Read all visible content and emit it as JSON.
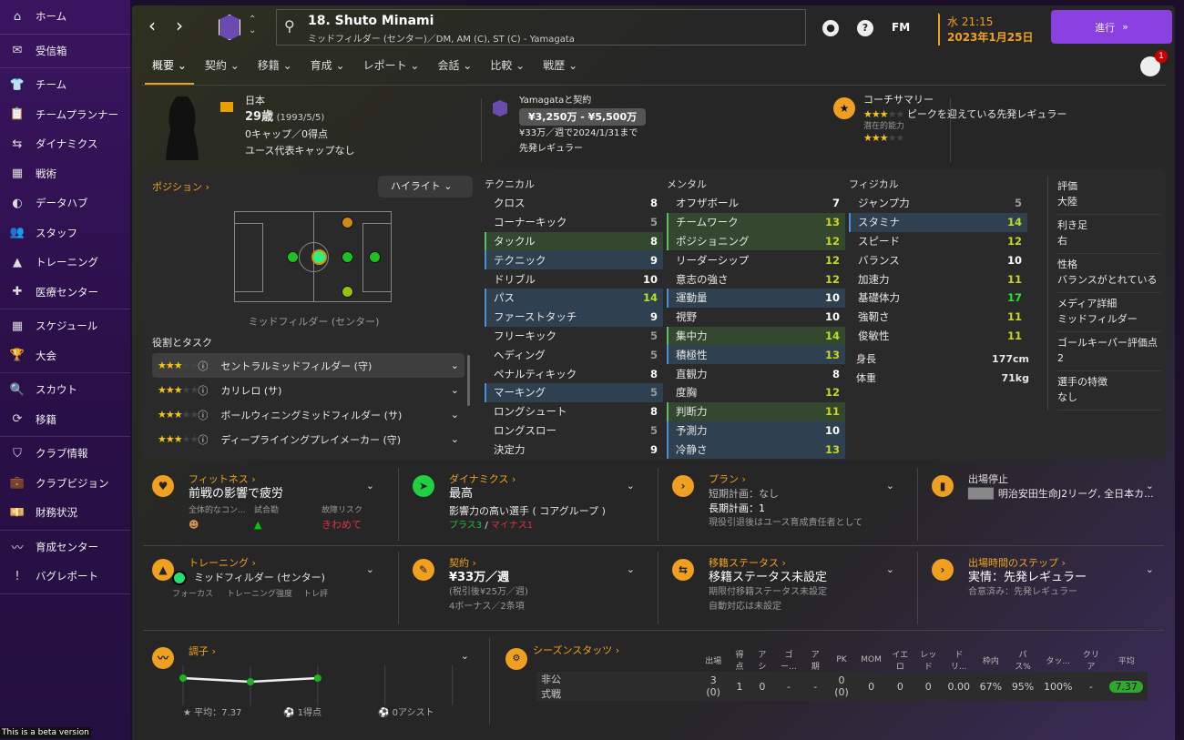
{
  "sidebar": {
    "groups": [
      [
        {
          "label": "ホーム",
          "icon": "home-icon",
          "glyph": "⌂"
        }
      ],
      [
        {
          "label": "受信箱",
          "icon": "inbox-icon",
          "glyph": "✉"
        }
      ],
      [
        {
          "label": "チーム",
          "icon": "team-shirt-icon",
          "glyph": "👕"
        },
        {
          "label": "チームプランナー",
          "icon": "clipboard-icon",
          "glyph": "📋"
        },
        {
          "label": "ダイナミクス",
          "icon": "dynamics-icon",
          "glyph": "⇆"
        },
        {
          "label": "戦術",
          "icon": "tactics-icon",
          "glyph": "▦"
        },
        {
          "label": "データハブ",
          "icon": "data-hub-icon",
          "glyph": "◐"
        },
        {
          "label": "スタッフ",
          "icon": "staff-icon",
          "glyph": "👥"
        },
        {
          "label": "トレーニング",
          "icon": "training-cone-icon",
          "glyph": "▲"
        },
        {
          "label": "医療センター",
          "icon": "medical-icon",
          "glyph": "✚"
        }
      ],
      [
        {
          "label": "スケジュール",
          "icon": "calendar-icon",
          "glyph": "▦"
        },
        {
          "label": "大会",
          "icon": "trophy-icon",
          "glyph": "🏆"
        }
      ],
      [
        {
          "label": "スカウト",
          "icon": "scout-search-icon",
          "glyph": "🔍"
        },
        {
          "label": "移籍",
          "icon": "transfer-icon",
          "glyph": "⟳"
        }
      ],
      [
        {
          "label": "クラブ情報",
          "icon": "club-shield-icon",
          "glyph": "⛉"
        },
        {
          "label": "クラブビジョン",
          "icon": "briefcase-icon",
          "glyph": "💼"
        },
        {
          "label": "財務状況",
          "icon": "finance-icon",
          "glyph": "💴"
        }
      ],
      [
        {
          "label": "育成センター",
          "icon": "development-icon",
          "glyph": "〰"
        },
        {
          "label": "バグレポート",
          "icon": "bug-report-icon",
          "glyph": "!"
        }
      ]
    ],
    "beta": "This is a beta version"
  },
  "header": {
    "player_name": "18. Shuto Minami",
    "player_sub": "ミッドフィルダー (センター)／DM, AM (C), ST (C) - Yamagata",
    "fm": "FM",
    "time": "水 21:15",
    "date": "2023年1月25日",
    "continue": "進行",
    "notifications": "1"
  },
  "tabs": [
    "概要",
    "契約",
    "移籍",
    "育成",
    "レポート",
    "会話",
    "比較",
    "戦歴"
  ],
  "profile": {
    "nation": "日本",
    "age": "29歳",
    "dob": "(1993/5/5)",
    "caps": "0キャップ／0得点",
    "youth_caps": "ユース代表キャップなし"
  },
  "contract": {
    "title": "Yamagataと契約",
    "value": "¥3,250万 - ¥5,500万",
    "wage": "¥33万／週で2024/1/31まで",
    "status": "先発レギュラー"
  },
  "coach": {
    "title": "コーチサマリー",
    "ability_stars": 3,
    "summary": "ピークを迎えている先発レギュラー",
    "potential_label": "潜在的能力",
    "potential_stars": 3
  },
  "position": {
    "title": "ポジション",
    "highlight": "ハイライト",
    "label": "ミッドフィルダー (センター)",
    "roles_title": "役割とタスク",
    "roles": [
      {
        "stars": 3,
        "name": "セントラルミッドフィルダー (守)"
      },
      {
        "stars": 3,
        "name": "カリレロ (サ)"
      },
      {
        "stars": 3,
        "name": "ボールウィニングミッドフィルダー (サ)"
      },
      {
        "stars": 3,
        "name": "ディープライイングプレイメーカー (守)"
      }
    ]
  },
  "attributes": {
    "technical": {
      "title": "テクニカル",
      "rows": [
        [
          "クロス",
          8,
          ""
        ],
        [
          "コーナーキック",
          5,
          ""
        ],
        [
          "タックル",
          8,
          "g"
        ],
        [
          "テクニック",
          9,
          "b"
        ],
        [
          "ドリブル",
          10,
          ""
        ],
        [
          "パス",
          14,
          "b"
        ],
        [
          "ファーストタッチ",
          9,
          "b"
        ],
        [
          "フリーキック",
          5,
          ""
        ],
        [
          "ヘディング",
          5,
          ""
        ],
        [
          "ペナルティキック",
          8,
          ""
        ],
        [
          "マーキング",
          5,
          "b"
        ],
        [
          "ロングシュート",
          8,
          ""
        ],
        [
          "ロングスロー",
          5,
          ""
        ],
        [
          "決定力",
          9,
          ""
        ]
      ]
    },
    "mental": {
      "title": "メンタル",
      "rows": [
        [
          "オフザボール",
          7,
          ""
        ],
        [
          "チームワーク",
          13,
          "g"
        ],
        [
          "ポジショニング",
          12,
          "g"
        ],
        [
          "リーダーシップ",
          12,
          ""
        ],
        [
          "意志の強さ",
          12,
          ""
        ],
        [
          "運動量",
          10,
          "b"
        ],
        [
          "視野",
          10,
          ""
        ],
        [
          "集中力",
          14,
          "g"
        ],
        [
          "積極性",
          13,
          "b"
        ],
        [
          "直観力",
          8,
          ""
        ],
        [
          "度胸",
          12,
          ""
        ],
        [
          "判断力",
          11,
          "g"
        ],
        [
          "予測力",
          10,
          "b"
        ],
        [
          "冷静さ",
          13,
          "b"
        ]
      ]
    },
    "physical": {
      "title": "フィジカル",
      "rows": [
        [
          "ジャンプ力",
          5,
          ""
        ],
        [
          "スタミナ",
          14,
          "b"
        ],
        [
          "スピード",
          12,
          ""
        ],
        [
          "バランス",
          10,
          ""
        ],
        [
          "加速力",
          11,
          ""
        ],
        [
          "基礎体力",
          17,
          ""
        ],
        [
          "強靭さ",
          11,
          ""
        ],
        [
          "俊敏性",
          11,
          ""
        ]
      ],
      "height_label": "身長",
      "height": "177cm",
      "weight_label": "体重",
      "weight": "71kg"
    }
  },
  "details": [
    {
      "label": "評価",
      "value": "大陸"
    },
    {
      "label": "利き足",
      "value": "右"
    },
    {
      "label": "性格",
      "value": "バランスがとれている"
    },
    {
      "label": "メディア詳細",
      "value": "ミッドフィルダー"
    },
    {
      "label": "ゴールキーパー評価点",
      "value": "2"
    },
    {
      "label": "選手の特徴",
      "value": "なし"
    }
  ],
  "cards": {
    "fitness": {
      "title": "フィットネス",
      "value": "前戦の影響で疲労",
      "c1": "全体的なコン...",
      "c2": "試合勘",
      "c3": "故障リスク",
      "risk": "きわめて"
    },
    "dynamics": {
      "title": "ダイナミクス",
      "value": "最高",
      "sub": "影響力の高い選手 ( コアグループ )",
      "plus": "プラス3",
      "sep": "/",
      "minus": "マイナス1"
    },
    "plan": {
      "title": "プラン",
      "short": "短期計画：なし",
      "long": "長期計画：1",
      "note": "現役引退後はユース育成責任者として"
    },
    "ban": {
      "title": "出場停止",
      "value": "明治安田生命J2リーグ, 全日本カ..."
    },
    "training": {
      "title": "トレーニング",
      "value": "ミッドフィルダー (センター)",
      "c1": "フォーカス",
      "c2": "トレーニング強度",
      "c3": "トレ評"
    },
    "contract": {
      "title": "契約",
      "value": "¥33万／週",
      "sub": "(税引後¥25万／週)",
      "note": "4ボーナス／2条項"
    },
    "transfer": {
      "title": "移籍ステータス",
      "value": "移籍ステータス未設定",
      "sub": "期限付移籍ステータス未設定",
      "note": "自動対応は未設定"
    },
    "playtime": {
      "title": "出場時間のステップ",
      "value": "実情：先発レギュラー",
      "sub": "合意済み：先発レギュラー"
    },
    "form": {
      "title": "調子",
      "avg": "平均：7.37",
      "goals": "1得点",
      "assists": "0アシスト",
      "ratings": [
        7.4,
        7.3,
        7.4
      ]
    }
  },
  "season": {
    "title": "シーズンスタッツ",
    "headers": [
      "出場",
      "得点",
      "アシ",
      "ゴー...",
      "ア期",
      "PK",
      "MOM",
      "イエロ",
      "レッド",
      "ドリ...",
      "枠内",
      "パス%",
      "タッ...",
      "クリア",
      "平均"
    ],
    "rows": [
      {
        "label": "非公式戦",
        "values": [
          "3 (0)",
          "1",
          "0",
          "-",
          "-",
          "0 (0)",
          "0",
          "0",
          "0",
          "0.00",
          "67%",
          "95%",
          "100%",
          "-",
          "7.37"
        ]
      }
    ]
  },
  "colors": {
    "accent": "#f0a020",
    "continue": "#8a3fe0"
  }
}
